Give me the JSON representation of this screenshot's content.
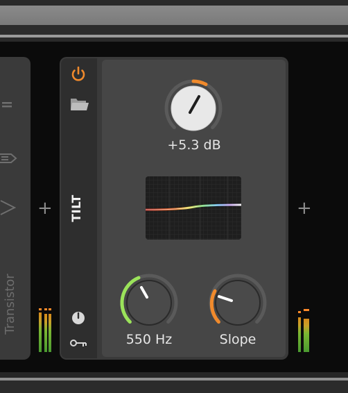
{
  "left_device": {
    "name": "Transistor"
  },
  "device": {
    "name": "TILT",
    "gain_knob": {
      "value_label": "+5.3 dB",
      "value": 0.55
    },
    "freq_knob": {
      "value_label": "550 Hz",
      "value": 0.35
    },
    "slope_knob": {
      "value_label": "Slope",
      "value": 0.25
    }
  },
  "add_buttons": {
    "left": "+",
    "right": "+"
  },
  "colors": {
    "accent_orange": "#f08a2c",
    "accent_green": "#9be35a",
    "knob_face": "#e8e8e8",
    "knob_dark": "#4a4a4a"
  },
  "icons": {
    "power": "power-icon",
    "folder": "folder-icon",
    "modulator": "modulator-icon",
    "key": "key-icon"
  }
}
